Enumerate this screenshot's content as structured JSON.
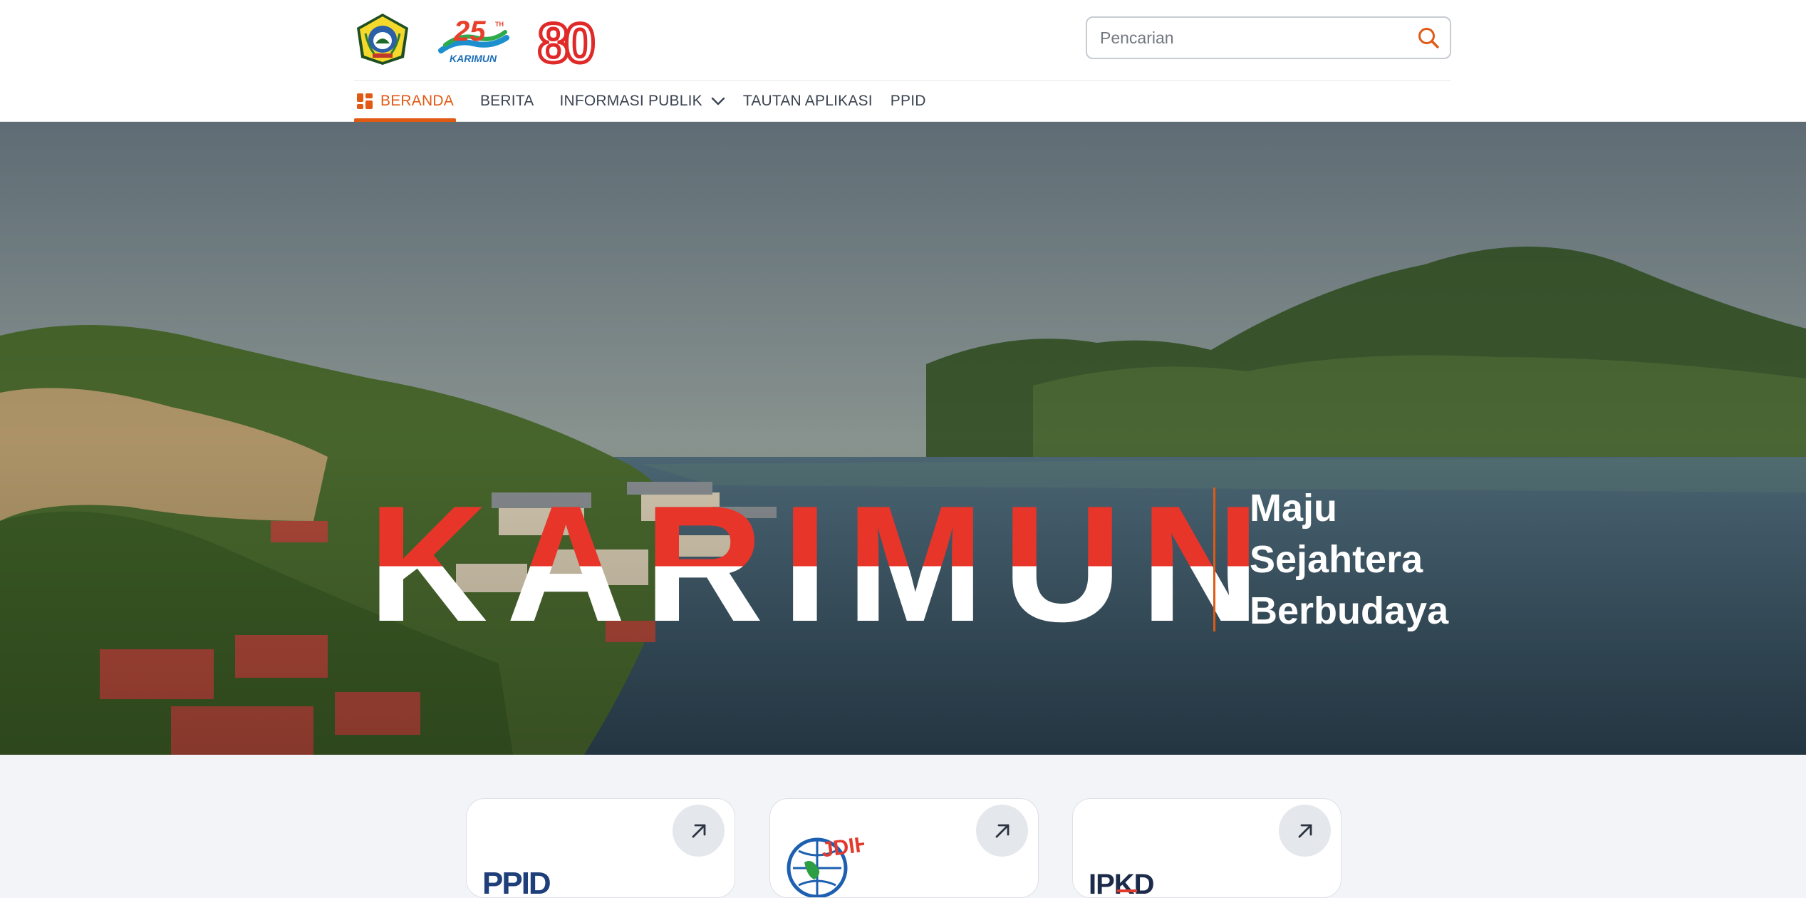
{
  "header": {
    "logos": [
      {
        "name": "karimun-regency-emblem",
        "alt": "Lambang Kabupaten Karimun"
      },
      {
        "name": "25th-anniversary-logo",
        "text": "KARIMUN"
      },
      {
        "name": "80th-independence-logo",
        "text": "80"
      }
    ],
    "search": {
      "placeholder": "Pencarian",
      "value": ""
    }
  },
  "nav": {
    "items": [
      {
        "label": "BERANDA",
        "active": true
      },
      {
        "label": "BERITA"
      },
      {
        "label": "INFORMASI PUBLIK",
        "dropdown": true
      },
      {
        "label": "TAUTAN APLIKASI"
      },
      {
        "label": "PPID"
      }
    ]
  },
  "hero": {
    "title": "KARIMUN",
    "tagline": [
      "Maju",
      "Sejahtera",
      "Berbudaya"
    ]
  },
  "cards": [
    {
      "logo_text": "PPID"
    },
    {
      "logo_text": "JDIH"
    },
    {
      "logo_text": "IPKD"
    }
  ],
  "colors": {
    "accent": "#e05a14",
    "hero_red": "#e8352a",
    "nav_text": "#3a4350",
    "card_arrow_bg": "#e4e7ec"
  }
}
